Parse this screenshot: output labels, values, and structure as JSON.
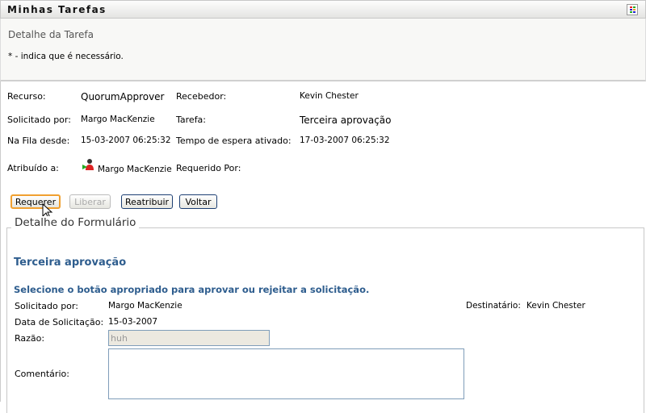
{
  "header": {
    "title": "Minhas Tarefas",
    "icon": "grid-icon"
  },
  "panel": {
    "subtitle": "Detalhe da Tarefa",
    "required_note": "* - indica que é necessário."
  },
  "details": {
    "recurso_label": "Recurso:",
    "recurso": "QuorumApprover",
    "recebedor_label": "Recebedor:",
    "recebedor": "Kevin Chester",
    "solicitado_label": "Solicitado por:",
    "solicitado": "Margo MacKenzie",
    "tarefa_label": "Tarefa:",
    "tarefa": "Terceira aprovação",
    "fila_label": "Na Fila desde:",
    "fila": "15-03-2007 06:25:32",
    "espera_label": "Tempo de espera ativado:",
    "espera": "17-03-2007 06:25:32",
    "atribuido_label": "Atribuído a:",
    "atribuido": "Margo MacKenzie",
    "requerido_label": "Requerido Por:"
  },
  "buttons": {
    "requerer": "Requerer",
    "liberar": "Liberar",
    "reatribuir": "Reatribuir",
    "voltar": "Voltar"
  },
  "form": {
    "legend": "Detalhe do Formulário",
    "title": "Terceira aprovação",
    "instruction": "Selecione o botão apropriado para aprovar ou rejeitar a solicitação.",
    "solicitado_label": "Solicitado por:",
    "solicitado": "Margo MacKenzie",
    "destinatario_label": "Destinatário:",
    "destinatario": "Kevin Chester",
    "data_label": "Data de Solicitação:",
    "data": "15-03-2007",
    "razao_label": "Razão:",
    "razao": "huh",
    "comentario_label": "Comentário:",
    "comentario": ""
  }
}
